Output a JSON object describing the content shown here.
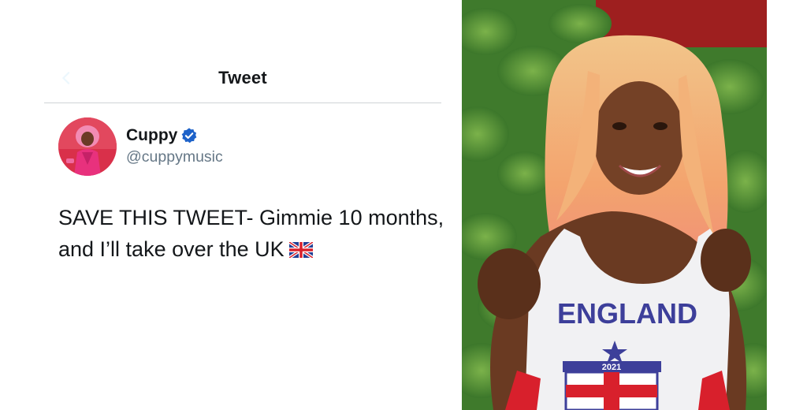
{
  "header": {
    "title": "Tweet"
  },
  "author": {
    "name": "Cuppy",
    "handle": "@cuppymusic",
    "verified": true
  },
  "tweet": {
    "text": "SAVE THIS TWEET- Gimmie 10 months, and I’ll take over the UK",
    "emoji": "uk-flag-icon"
  },
  "photo": {
    "shirt_text": "ENGLAND",
    "shirt_year": "2021"
  },
  "colors": {
    "text_primary": "#14171a",
    "text_secondary": "#657786",
    "verified_blue": "#1d62c9",
    "divider": "#cfd3d6",
    "shirt_letters": "#3d3f9a",
    "flag_red": "#d8202c"
  }
}
